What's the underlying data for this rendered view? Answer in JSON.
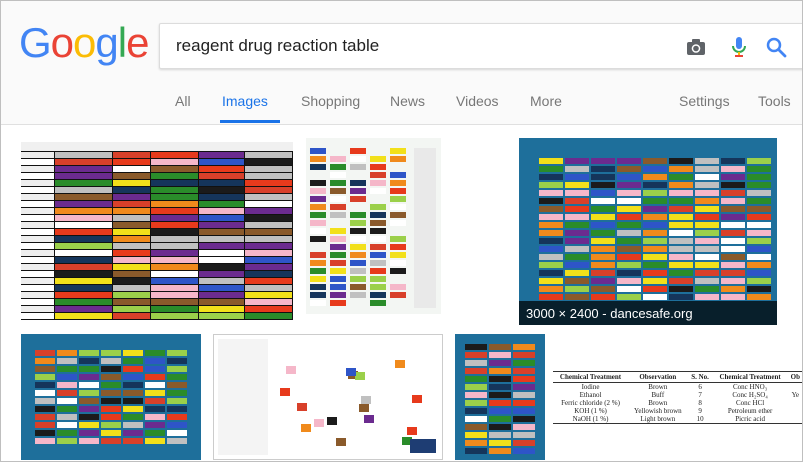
{
  "search": {
    "query": "reagent drug reaction table"
  },
  "logo": {
    "letters": [
      "G",
      "o",
      "o",
      "g",
      "l",
      "e"
    ],
    "colors": [
      "#4285f4",
      "#ea4335",
      "#fbbc05",
      "#4285f4",
      "#34a853",
      "#ea4335"
    ]
  },
  "tabs": {
    "all": "All",
    "images": "Images",
    "shopping": "Shopping",
    "news": "News",
    "videos": "Videos",
    "more": "More",
    "settings": "Settings",
    "tools": "Tools"
  },
  "colors": {
    "accent": "#1a73e8",
    "tab_text": "#777777"
  },
  "results": {
    "image3_caption": "3000 × 2400 - dancesafe.org",
    "chemical_table": {
      "headers": [
        "Chemical Treatment",
        "Observation",
        "S. No.",
        "Chemical Treatment",
        "Ob"
      ],
      "rows": [
        [
          "Iodine",
          "Brown",
          "6",
          "Conc HNO₃",
          ""
        ],
        [
          "Ethanol",
          "Buff",
          "7",
          "Conc H₂SO₄",
          "Ye"
        ],
        [
          "Ferric chloride (2 %)",
          "Brown",
          "8",
          "Conc HCl",
          ""
        ],
        [
          "KOH (1 %)",
          "Yellowish brown",
          "9",
          "Petroleum ether",
          ""
        ],
        [
          "NaOH (1 %)",
          "Light brown",
          "10",
          "Picric acid",
          ""
        ]
      ]
    }
  },
  "icons": {
    "camera": "camera-icon",
    "mic": "mic-icon",
    "search": "search-icon"
  }
}
